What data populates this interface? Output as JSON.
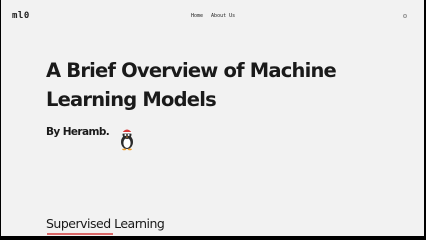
{
  "navbar": {
    "logo": "ml0",
    "links": [
      {
        "label": "Home"
      },
      {
        "label": "About Us"
      }
    ]
  },
  "article": {
    "title": "A Brief Overview of Machine Learning Models",
    "author": "By Heramb.",
    "mascot_icon": "penguin-mascot-icon",
    "section_heading": "Supervised Learning"
  },
  "colors": {
    "background": "#f2f2f2",
    "text": "#1a1a1a",
    "accent_underline": "#d23a3a",
    "frame": "#000000"
  }
}
